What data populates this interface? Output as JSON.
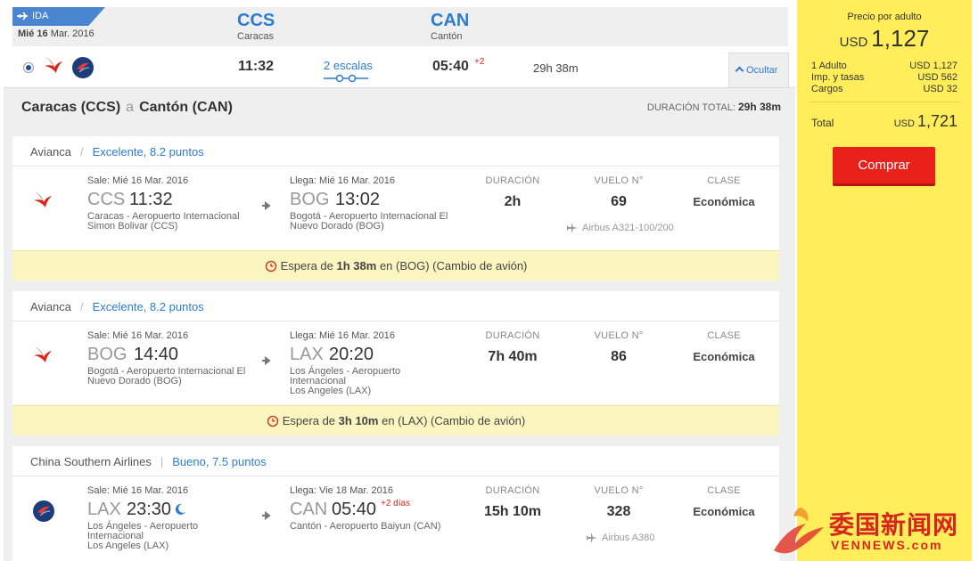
{
  "header": {
    "tag": "IDA",
    "date_day": "Mié 16",
    "date_rest": "Mar. 2016",
    "origin_code": "CCS",
    "origin_city": "Caracas",
    "dest_code": "CAN",
    "dest_city": "Cantón"
  },
  "summary": {
    "depart": "11:32",
    "stops": "2 escalas",
    "arrive": "05:40",
    "plus": "+2",
    "duration": "29h 38m",
    "hide": "Ocultar"
  },
  "route": {
    "origin": "Caracas (CCS)",
    "sep": "a",
    "dest": "Cantón (CAN)",
    "total_label": "DURACIÓN TOTAL:",
    "total_value": "29h 38m"
  },
  "segments": [
    {
      "airline": "Avianca",
      "rating": "Excelente, 8.2 puntos",
      "dep_label": "Sale: Mié 16 Mar. 2016",
      "dep_code": "CCS",
      "dep_time": "11:32",
      "dep_airport_1": "Caracas - Aeropuerto Internacional",
      "dep_airport_2": "Simon Bolivar (CCS)",
      "arr_label": "Llega: Mié 16 Mar. 2016",
      "arr_code": "BOG",
      "arr_time": "13:02",
      "arr_airport_1": "Bogotá - Aeropuerto Internacional El",
      "arr_airport_2": "Nuevo Dorado (BOG)",
      "duration": "2h",
      "flight": "69",
      "class": "Económica",
      "aircraft": "Airbus A321-100/200"
    },
    {
      "airline": "Avianca",
      "rating": "Excelente, 8.2 puntos",
      "dep_label": "Sale: Mié 16 Mar. 2016",
      "dep_code": "BOG",
      "dep_time": "14:40",
      "dep_airport_1": "Bogotá - Aeropuerto Internacional El",
      "dep_airport_2": "Nuevo Dorado (BOG)",
      "arr_label": "Llega: Mié 16 Mar. 2016",
      "arr_code": "LAX",
      "arr_time": "20:20",
      "arr_airport_1": "Los Ángeles - Aeropuerto Internacional",
      "arr_airport_2": "Los Angeles (LAX)",
      "duration": "7h 40m",
      "flight": "86",
      "class": "Económica"
    },
    {
      "airline": "China Southern Airlines",
      "rating": "Bueno, 7.5 puntos",
      "dep_label": "Sale: Mié 16 Mar. 2016",
      "dep_code": "LAX",
      "dep_time": "23:30",
      "dep_airport_1": "Los Ángeles - Aeropuerto Internacional",
      "dep_airport_2": "Los Angeles (LAX)",
      "arr_label": "Llega: Vie 18 Mar. 2016",
      "arr_code": "CAN",
      "arr_time": "05:40",
      "arr_plus": "+2 días",
      "arr_airport_1": "Cantón - Aeropuerto Baiyun (CAN)",
      "duration": "15h 10m",
      "flight": "328",
      "class": "Económica",
      "aircraft": "Airbus A380"
    }
  ],
  "columns": {
    "duration": "DURACIÓN",
    "flight": "VUELO N°",
    "class": "CLASE"
  },
  "layovers": [
    {
      "pre": "Espera de",
      "time": "1h 38m",
      "post": "en (BOG) (Cambio de avión)"
    },
    {
      "pre": "Espera de",
      "time": "3h 10m",
      "post": "en (LAX) (Cambio de avión)"
    }
  ],
  "price": {
    "label": "Precio por adulto",
    "currency": "USD",
    "per_adult": "1,127",
    "rows": [
      {
        "label": "1 Adulto",
        "value": "USD 1,127"
      },
      {
        "label": "Imp. y tasas",
        "value": "USD 562"
      },
      {
        "label": "Cargos",
        "value": "USD 32"
      }
    ],
    "total_label": "Total",
    "total_currency": "USD",
    "total": "1,721",
    "buy": "Comprar"
  },
  "watermark": {
    "text": "委国新闻网",
    "sub": "VENNEWS.com"
  },
  "colors": {
    "accent": "#2c7cd1",
    "price_panel": "#ffee5a",
    "buy": "#e8221b",
    "layover": "#fbf5c0"
  }
}
